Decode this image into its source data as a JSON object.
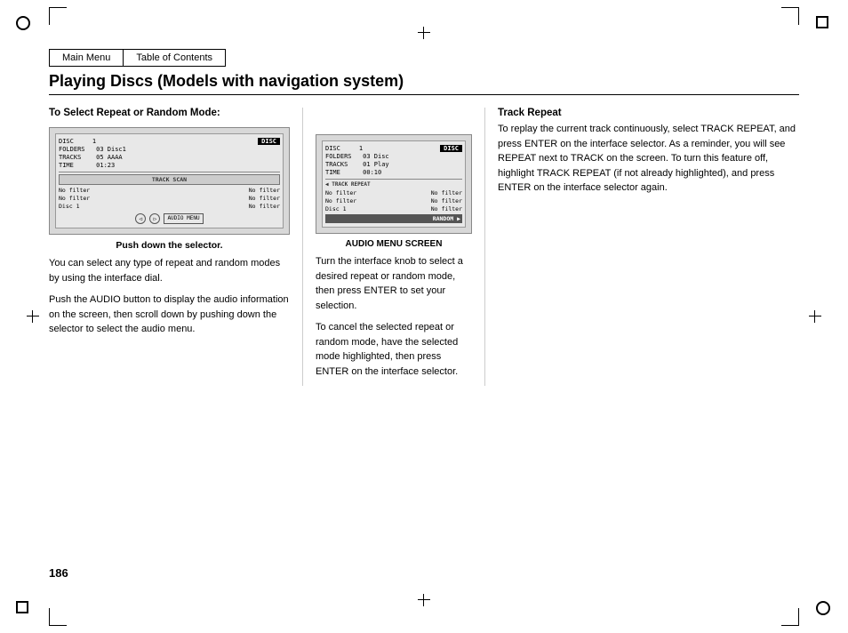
{
  "page": {
    "number": "186",
    "nav": {
      "main_menu": "Main Menu",
      "table_of_contents": "Table of Contents"
    },
    "title": "Playing Discs (Models with navigation system)",
    "left_col": {
      "section_label": "To Select Repeat or Random Mode:",
      "screen1": {
        "disc_label": "DISC",
        "rows": [
          {
            "left": "DISC",
            "right": "1"
          },
          {
            "left": "FOLDERS",
            "right": "03 Disc1"
          },
          {
            "left": "TRACKS",
            "right": "05 AAAA"
          },
          {
            "left": "TIME",
            "right": "01:23"
          }
        ],
        "sub_rows": [
          {
            "left": "No filter",
            "right": "No filter"
          },
          {
            "left": "No filter",
            "right": "No filter"
          },
          {
            "left": "Disc 1",
            "right": "No filter"
          }
        ],
        "section_label": "TRACK SCAN"
      },
      "caption": "Push down the selector.",
      "body_paragraphs": [
        "You can select any type of repeat and random modes by using the interface dial.",
        "Push the AUDIO button to display the audio information on the screen, then scroll down by pushing down the selector to select the audio menu."
      ]
    },
    "middle_col": {
      "screen2": {
        "disc_label": "DISC",
        "rows": [
          {
            "left": "DISC",
            "right": "1"
          },
          {
            "left": "FOLDERS",
            "right": "03 Disc"
          },
          {
            "left": "TRACKS",
            "right": "01 Play"
          },
          {
            "left": "TIME",
            "right": "00:10"
          }
        ],
        "track_repeat_label": "TRACK REPEAT",
        "sub_rows": [
          {
            "left": "No filter",
            "right": "No filter"
          },
          {
            "left": "No filter",
            "right": "No filter"
          },
          {
            "left": "Disc 1",
            "right": "No filter"
          }
        ],
        "highlighted": "RANDOM"
      },
      "caption": "AUDIO MENU SCREEN",
      "body_paragraphs": [
        "Turn the interface knob to select a desired repeat or random mode, then press ENTER to set your selection.",
        "To cancel the selected repeat or random mode, have the selected mode highlighted, then press ENTER on the interface selector."
      ]
    },
    "right_col": {
      "track_repeat_title": "Track Repeat",
      "body_text": "To replay the current track continuously, select TRACK REPEAT, and press ENTER on the interface selector. As a reminder, you will see REPEAT next to TRACK on the screen. To turn this feature off, highlight TRACK REPEAT (if not already highlighted), and press ENTER on the interface selector again."
    }
  }
}
